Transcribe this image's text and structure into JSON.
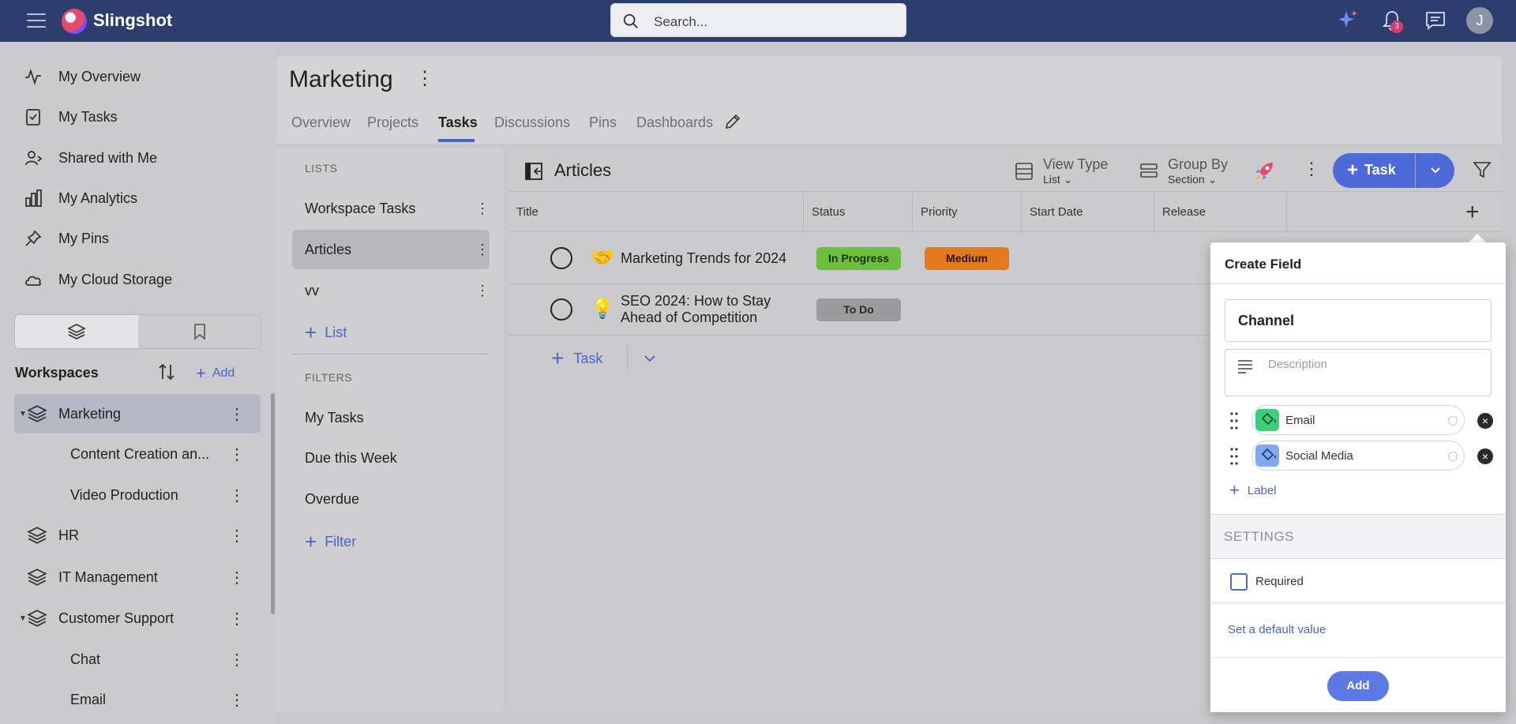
{
  "app": {
    "name": "Slingshot",
    "user_initial": "J",
    "notification_count": "3"
  },
  "search": {
    "placeholder": "Search..."
  },
  "nav": {
    "items": [
      "My Overview",
      "My Tasks",
      "Shared with Me",
      "My Analytics",
      "My Pins",
      "My Cloud Storage"
    ]
  },
  "workspaces": {
    "title": "Workspaces",
    "add_label": "Add",
    "items": [
      {
        "label": "Marketing",
        "level": 0,
        "expanded": true,
        "active": true
      },
      {
        "label": "Content Creation an...",
        "level": 1
      },
      {
        "label": "Video Production",
        "level": 1
      },
      {
        "label": "HR",
        "level": 0
      },
      {
        "label": "IT Management",
        "level": 0
      },
      {
        "label": "Customer Support",
        "level": 0,
        "expanded": true
      },
      {
        "label": "Chat",
        "level": 1
      },
      {
        "label": "Email",
        "level": 1
      }
    ]
  },
  "project": {
    "title": "Marketing",
    "tabs": [
      "Overview",
      "Projects",
      "Tasks",
      "Discussions",
      "Pins",
      "Dashboards"
    ],
    "active_tab": "Tasks"
  },
  "lists": {
    "section_label": "LISTS",
    "items": [
      "Workspace Tasks",
      "Articles",
      "vv"
    ],
    "active": "Articles",
    "add_label": "List"
  },
  "filters": {
    "section_label": "FILTERS",
    "items": [
      "My Tasks",
      "Due this Week",
      "Overdue"
    ],
    "add_label": "Filter"
  },
  "tasks": {
    "title": "Articles",
    "view_type": {
      "label": "View Type",
      "value": "List"
    },
    "group_by": {
      "label": "Group By",
      "value": "Section"
    },
    "task_button": "Task",
    "columns": [
      "Title",
      "Status",
      "Priority",
      "Start Date",
      "Release"
    ],
    "rows": [
      {
        "title": "Marketing Trends for 2024",
        "emoji": "🤝",
        "status": "In Progress",
        "status_color": "#6bbf3a",
        "priority": "Medium",
        "priority_color": "#e57a1c"
      },
      {
        "title": "SEO 2024: How to Stay Ahead of Competition",
        "emoji": "💡",
        "status": "To Do",
        "status_color": "#9b9b9e",
        "priority": "",
        "priority_color": ""
      }
    ],
    "add_task_label": "Task"
  },
  "create_field": {
    "title": "Create Field",
    "name_value": "Channel",
    "description_placeholder": "Description",
    "labels": [
      {
        "label": "Email",
        "color": "#3ccf7a",
        "icon": "paint-bucket-icon"
      },
      {
        "label": "Social Media",
        "color": "#7fa8f0",
        "icon": "paint-bucket-icon"
      }
    ],
    "add_label": "Label",
    "settings_label": "SETTINGS",
    "required_label": "Required",
    "required_checked": false,
    "default_value_link": "Set a default value",
    "add_button": "Add"
  },
  "colors": {
    "topbar": "#2d3e6e",
    "accent": "#4e6ad9"
  }
}
